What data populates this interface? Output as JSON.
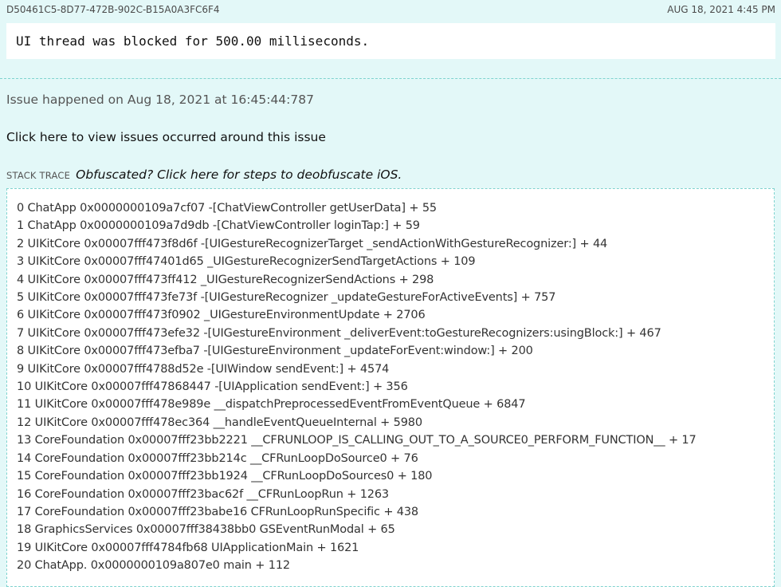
{
  "header": {
    "report_id": "D50461C5-8D77-472B-902C-B15A0A3FC6F4",
    "report_date": "AUG 18, 2021 4:45 PM"
  },
  "message": "UI thread was blocked for 500.00 milliseconds.",
  "issue_time": "Issue happened on Aug 18, 2021 at 16:45:44:787",
  "view_around_link": "Click here to view issues occurred around this issue",
  "stack": {
    "label": "STACK TRACE",
    "deobfuscate_link": "Obfuscated? Click here for steps to deobfuscate iOS.",
    "frames": [
      "0 ChatApp 0x0000000109a7cf07 -[ChatViewController getUserData] + 55",
      "1 ChatApp 0x0000000109a7d9db -[ChatViewController loginTap:] + 59",
      "2 UIKitCore 0x00007fff473f8d6f -[UIGestureRecognizerTarget _sendActionWithGestureRecognizer:] + 44",
      "3 UIKitCore 0x00007fff47401d65 _UIGestureRecognizerSendTargetActions + 109",
      "4 UIKitCore 0x00007fff473ff412 _UIGestureRecognizerSendActions + 298",
      "5 UIKitCore 0x00007fff473fe73f -[UIGestureRecognizer _updateGestureForActiveEvents] + 757",
      "6 UIKitCore 0x00007fff473f0902 _UIGestureEnvironmentUpdate + 2706",
      "7 UIKitCore 0x00007fff473efe32 -[UIGestureEnvironment _deliverEvent:toGestureRecognizers:usingBlock:] + 467",
      "8 UIKitCore 0x00007fff473efba7 -[UIGestureEnvironment _updateForEvent:window:] + 200",
      "9 UIKitCore 0x00007fff4788d52e -[UIWindow sendEvent:] + 4574",
      "10 UIKitCore 0x00007fff47868447 -[UIApplication sendEvent:] + 356",
      "11 UIKitCore 0x00007fff478e989e __dispatchPreprocessedEventFromEventQueue + 6847",
      "12 UIKitCore 0x00007fff478ec364 __handleEventQueueInternal + 5980",
      "13 CoreFoundation 0x00007fff23bb2221 __CFRUNLOOP_IS_CALLING_OUT_TO_A_SOURCE0_PERFORM_FUNCTION__ + 17",
      "14 CoreFoundation 0x00007fff23bb214c __CFRunLoopDoSource0 + 76",
      "15 CoreFoundation 0x00007fff23bb1924 __CFRunLoopDoSources0 + 180",
      "16 CoreFoundation 0x00007fff23bac62f __CFRunLoopRun + 1263",
      "17 CoreFoundation 0x00007fff23babe16 CFRunLoopRunSpecific + 438",
      "18 GraphicsServices 0x00007fff38438bb0 GSEventRunModal + 65",
      "19 UIKitCore 0x00007fff4784fb68 UIApplicationMain + 1621",
      "20 ChatApp. 0x0000000109a807e0 main + 112"
    ]
  }
}
